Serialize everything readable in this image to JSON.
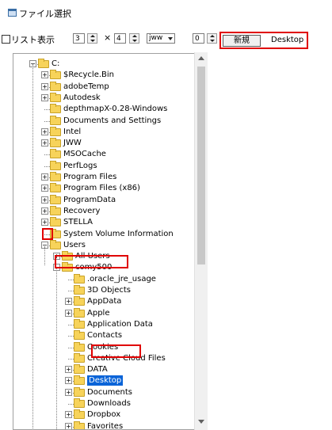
{
  "window": {
    "title": "ファイル選択"
  },
  "toolbar": {
    "list_checkbox_label": "リスト表示",
    "cols_value": "3",
    "times_sign": "×",
    "rows_value": "4",
    "ext_value": "jww",
    "extra_value": "0",
    "new_button_label": "新規",
    "current_path": "Desktop"
  },
  "tree": {
    "root": "C:",
    "items": [
      "$Recycle.Bin",
      "adobeTemp",
      "Autodesk",
      "depthmapX-0.28-Windows",
      "Documents and Settings",
      "Intel",
      "JWW",
      "MSOCache",
      "PerfLogs",
      "Program Files",
      "Program Files (x86)",
      "ProgramData",
      "Recovery",
      "STELLA",
      "System Volume Information",
      "Users",
      "All Users",
      "comy500",
      ".oracle_jre_usage",
      "3D Objects",
      "AppData",
      "Apple",
      "Application Data",
      "Contacts",
      "Cookies",
      "Creative Cloud Files",
      "DATA",
      "Desktop",
      "Documents",
      "Downloads",
      "Dropbox",
      "Favorites"
    ]
  },
  "colors": {
    "highlight": "#e00000",
    "selection": "#0a64d8",
    "folder": "#f7d35a"
  }
}
